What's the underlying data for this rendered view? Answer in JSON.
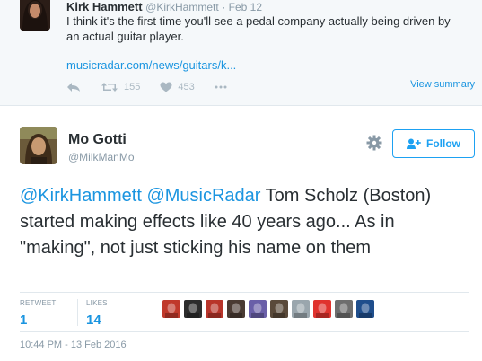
{
  "parent_tweet": {
    "name": "Kirk Hammett",
    "handle": "@KirkHammett",
    "date": "· Feb 12",
    "text": "I think it's the first time you'll see a pedal company actually being driven by an actual guitar player.",
    "link": "musicradar.com/news/guitars/k...",
    "retweets": "155",
    "likes": "453",
    "view_summary": "View summary"
  },
  "tweet": {
    "name": "Mo Gotti",
    "handle": "@MilkManMo",
    "follow_label": "Follow",
    "mention1": "@KirkHammett",
    "mention2": "@MusicRadar",
    "body": " Tom Scholz (Boston) started making effects like 40 years ago... As in \"making\", not just sticking his name on them",
    "retweet_label": "RETWEET",
    "retweet_count": "1",
    "likes_label": "LIKES",
    "likes_count": "14",
    "timestamp": "10:44 PM - 13 Feb 2016"
  },
  "liker_avatars": [
    {
      "color": "#c0392b"
    },
    {
      "color": "#2c2c2c"
    },
    {
      "color": "#b8342a"
    },
    {
      "color": "#4a3b33"
    },
    {
      "color": "#6a5fa8"
    },
    {
      "color": "#5a4a3a"
    },
    {
      "color": "#9aa6ad"
    },
    {
      "color": "#e0332e"
    },
    {
      "color": "#6e6e6e"
    },
    {
      "color": "#1f4e8c"
    }
  ],
  "colors": {
    "accent": "#1da1f2",
    "link": "#1b95e0",
    "muted": "#8899a6"
  }
}
